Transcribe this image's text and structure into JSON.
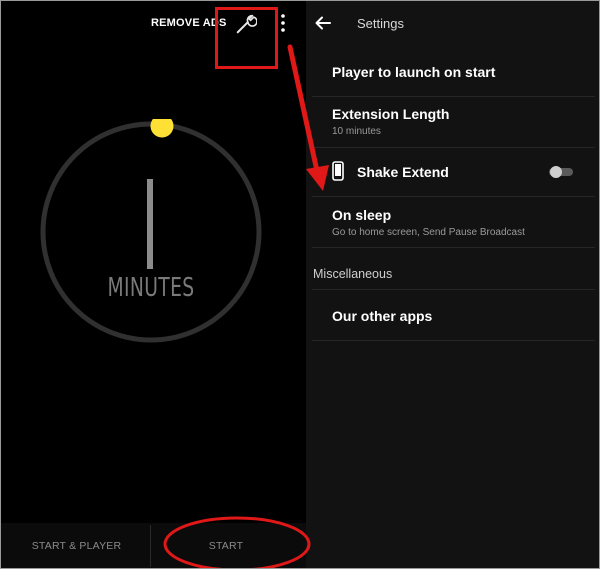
{
  "timer": {
    "remove_ads_label": "REMOVE ADS",
    "minutes_value": "1",
    "minutes_label": "MINUTES",
    "start_player_label": "START & PLAYER",
    "start_label": "START",
    "icons": [
      "wrench-icon",
      "more-vert-icon"
    ]
  },
  "settings": {
    "title": "Settings",
    "items": [
      {
        "title": "Player to launch on start",
        "subtitle": ""
      },
      {
        "title": "Extension Length",
        "subtitle": "10 minutes"
      },
      {
        "title": "Shake Extend",
        "subtitle": ""
      },
      {
        "title": "On sleep",
        "subtitle": "Go to home screen, Send Pause Broadcast"
      }
    ],
    "section_header": "Miscellaneous",
    "other_items": [
      {
        "title": "Our other apps"
      }
    ],
    "shake_extend_enabled": false
  },
  "colors": {
    "accent": "#FFE135",
    "annotation": "#E01818",
    "left_bg": "#000000",
    "right_bg": "#121212"
  }
}
